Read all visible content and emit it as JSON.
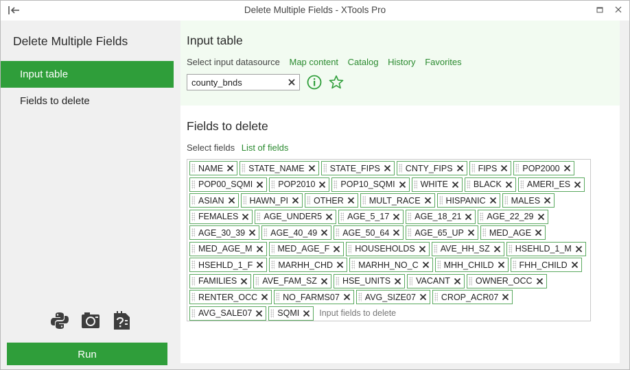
{
  "window": {
    "title": "Delete Multiple Fields - XTools Pro"
  },
  "sidebar": {
    "title": "Delete Multiple Fields",
    "items": [
      {
        "label": "Input table",
        "active": true
      },
      {
        "label": "Fields to delete",
        "active": false
      }
    ],
    "tools": [
      "python-icon",
      "camera-icon",
      "help-document-icon"
    ],
    "run_label": "Run"
  },
  "input_table": {
    "title": "Input table",
    "select_label": "Select input datasource",
    "links": [
      "Map content",
      "Catalog",
      "History",
      "Favorites"
    ],
    "datasource_value": "county_bnds"
  },
  "fields_to_delete": {
    "title": "Fields to delete",
    "select_label": "Select fields",
    "list_link": "List of fields",
    "fields": [
      "NAME",
      "STATE_NAME",
      "STATE_FIPS",
      "CNTY_FIPS",
      "FIPS",
      "POP2000",
      "POP00_SQMI",
      "POP2010",
      "POP10_SQMI",
      "WHITE",
      "BLACK",
      "AMERI_ES",
      "ASIAN",
      "HAWN_PI",
      "OTHER",
      "MULT_RACE",
      "HISPANIC",
      "MALES",
      "FEMALES",
      "AGE_UNDER5",
      "AGE_5_17",
      "AGE_18_21",
      "AGE_22_29",
      "AGE_30_39",
      "AGE_40_49",
      "AGE_50_64",
      "AGE_65_UP",
      "MED_AGE",
      "MED_AGE_M",
      "MED_AGE_F",
      "HOUSEHOLDS",
      "AVE_HH_SZ",
      "HSEHLD_1_M",
      "HSEHLD_1_F",
      "MARHH_CHD",
      "MARHH_NO_C",
      "MHH_CHILD",
      "FHH_CHILD",
      "FAMILIES",
      "AVE_FAM_SZ",
      "HSE_UNITS",
      "VACANT",
      "OWNER_OCC",
      "RENTER_OCC",
      "NO_FARMS07",
      "AVG_SIZE07",
      "CROP_ACR07",
      "AVG_SALE07",
      "SQMI"
    ],
    "placeholder": "Input fields to delete"
  },
  "colors": {
    "accent": "#2f9e3a",
    "link": "#2a8a2f",
    "chip_border": "#5aa95f"
  }
}
